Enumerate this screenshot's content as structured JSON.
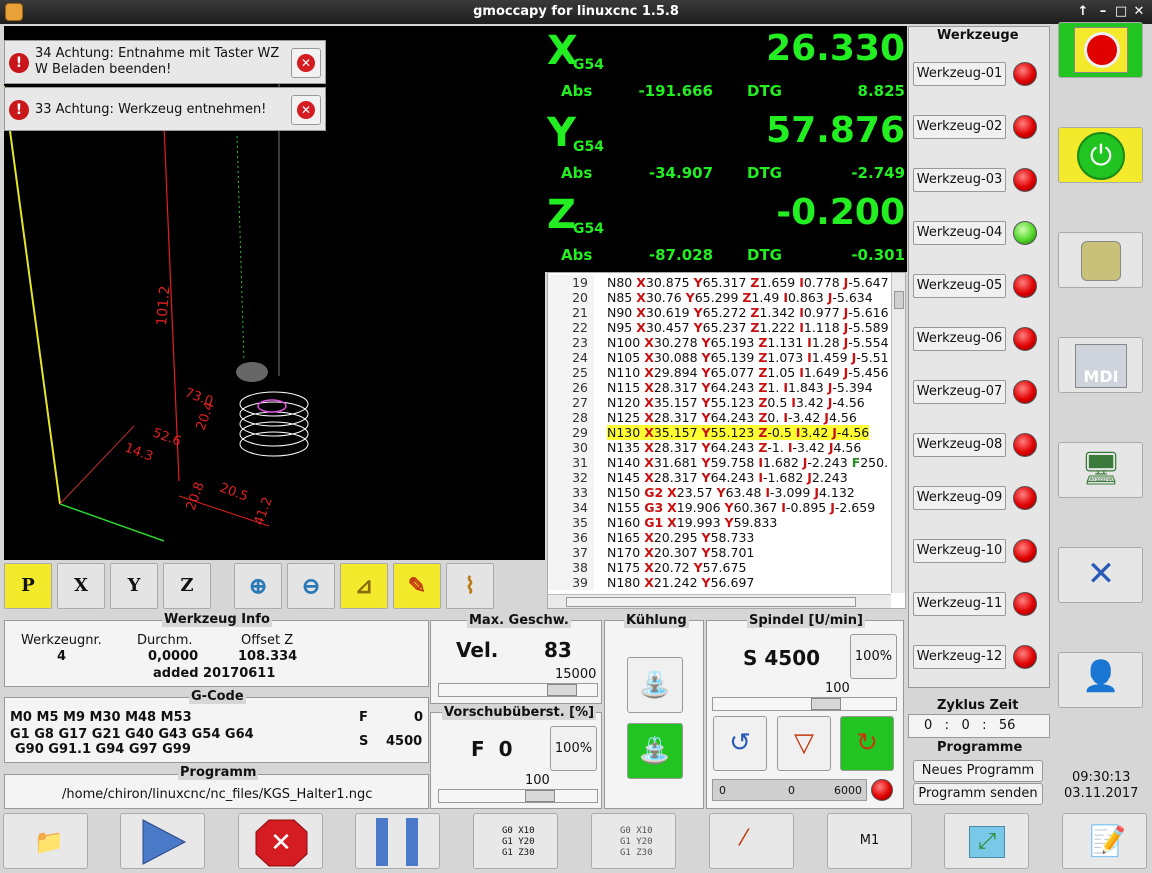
{
  "window": {
    "title": "gmoccapy for linuxcnc  1.5.8"
  },
  "messages": [
    {
      "text": "34 Achtung: Entnahme mit Taster WZ W Beladen beenden!"
    },
    {
      "text": "33 Achtung: Werkzeug entnehmen!"
    }
  ],
  "view_labels": {
    "d1": "101.2",
    "d2": "73.0",
    "d3": "20.4",
    "d4": "52.6",
    "d5": "14.3",
    "d6": "20.8",
    "d7": "20.5",
    "d8": "41.2"
  },
  "view_tools": {
    "p": "P",
    "x": "X",
    "y": "Y",
    "z": "Z"
  },
  "dro": [
    {
      "axis": "X",
      "sys": "G54",
      "value": "26.330",
      "abs_label": "Abs",
      "abs": "-191.666",
      "dtg_label": "DTG",
      "dtg": "8.825"
    },
    {
      "axis": "Y",
      "sys": "G54",
      "value": "57.876",
      "abs_label": "Abs",
      "abs": "-34.907",
      "dtg_label": "DTG",
      "dtg": "-2.749"
    },
    {
      "axis": "Z",
      "sys": "G54",
      "value": "-0.200",
      "abs_label": "Abs",
      "abs": "-87.028",
      "dtg_label": "DTG",
      "dtg": "-0.301"
    }
  ],
  "gcode_lines": [
    {
      "n": "19",
      "html": "N80 <b class='r'>X</b>30.875 <b class='r'>Y</b>65.317 <b class='r'>Z</b>1.659 <b class='r'>I</b>0.778 <b class='r'>J</b>-5.647"
    },
    {
      "n": "20",
      "html": "N85 <b class='r'>X</b>30.76 <b class='r'>Y</b>65.299 <b class='r'>Z</b>1.49 <b class='r'>I</b>0.863 <b class='r'>J</b>-5.634"
    },
    {
      "n": "21",
      "html": "N90 <b class='r'>X</b>30.619 <b class='r'>Y</b>65.272 <b class='r'>Z</b>1.342 <b class='r'>I</b>0.977 <b class='r'>J</b>-5.616"
    },
    {
      "n": "22",
      "html": "N95 <b class='r'>X</b>30.457 <b class='r'>Y</b>65.237 <b class='r'>Z</b>1.222 <b class='r'>I</b>1.118 <b class='r'>J</b>-5.589"
    },
    {
      "n": "23",
      "html": "N100 <b class='r'>X</b>30.278 <b class='r'>Y</b>65.193 <b class='r'>Z</b>1.131 <b class='r'>I</b>1.28 <b class='r'>J</b>-5.554"
    },
    {
      "n": "24",
      "html": "N105 <b class='r'>X</b>30.088 <b class='r'>Y</b>65.139 <b class='r'>Z</b>1.073 <b class='r'>I</b>1.459 <b class='r'>J</b>-5.51"
    },
    {
      "n": "25",
      "html": "N110 <b class='r'>X</b>29.894 <b class='r'>Y</b>65.077 <b class='r'>Z</b>1.05 <b class='r'>I</b>1.649 <b class='r'>J</b>-5.456"
    },
    {
      "n": "26",
      "html": "N115 <b class='r'>X</b>28.317 <b class='r'>Y</b>64.243 <b class='r'>Z</b>1. <b class='r'>I</b>1.843 <b class='r'>J</b>-5.394"
    },
    {
      "n": "27",
      "html": "N120 <b class='r'>X</b>35.157 <b class='r'>Y</b>55.123 <b class='r'>Z</b>0.5 <b class='r'>I</b>3.42 <b class='r'>J</b>-4.56"
    },
    {
      "n": "28",
      "html": "N125 <b class='r'>X</b>28.317 <b class='r'>Y</b>64.243 <b class='r'>Z</b>0. <b class='r'>I</b>-3.42 <b class='r'>J</b>4.56"
    },
    {
      "n": "29",
      "html": "N130 <b class='r'>X</b>35.157 <b class='r'>Y</b>55.123 <b class='r'>Z</b>-0.5 <b class='r'>I</b>3.42 <b class='r'>J</b>-4.56",
      "hl": true
    },
    {
      "n": "30",
      "html": "N135 <b class='r'>X</b>28.317 <b class='r'>Y</b>64.243 <b class='r'>Z</b>-1. <b class='r'>I</b>-3.42 <b class='r'>J</b>4.56"
    },
    {
      "n": "31",
      "html": "N140 <b class='r'>X</b>31.681 <b class='r'>Y</b>59.758 <b class='r'>I</b>1.682 <b class='r'>J</b>-2.243 <b class='g'>F</b>250."
    },
    {
      "n": "32",
      "html": "N145 <b class='r'>X</b>28.317 <b class='r'>Y</b>64.243 <b class='r'>I</b>-1.682 <b class='r'>J</b>2.243"
    },
    {
      "n": "33",
      "html": "N150 <b class='r'>G2</b> <b class='r'>X</b>23.57 <b class='r'>Y</b>63.48 <b class='r'>I</b>-3.099 <b class='r'>J</b>4.132"
    },
    {
      "n": "34",
      "html": "N155 <b class='r'>G3</b> <b class='r'>X</b>19.906 <b class='r'>Y</b>60.367 <b class='r'>I</b>-0.895 <b class='r'>J</b>-2.659"
    },
    {
      "n": "35",
      "html": "N160 <b class='r'>G1</b> <b class='r'>X</b>19.993 <b class='r'>Y</b>59.833"
    },
    {
      "n": "36",
      "html": "N165 <b class='r'>X</b>20.295 <b class='r'>Y</b>58.733"
    },
    {
      "n": "37",
      "html": "N170 <b class='r'>X</b>20.307 <b class='r'>Y</b>58.701"
    },
    {
      "n": "38",
      "html": "N175 <b class='r'>X</b>20.72 <b class='r'>Y</b>57.675"
    },
    {
      "n": "39",
      "html": "N180 <b class='r'>X</b>21.242 <b class='r'>Y</b>56.697"
    }
  ],
  "tools": {
    "title": "Werkzeuge",
    "items": [
      {
        "label": "Werkzeug-01",
        "active": false
      },
      {
        "label": "Werkzeug-02",
        "active": false
      },
      {
        "label": "Werkzeug-03",
        "active": false
      },
      {
        "label": "Werkzeug-04",
        "active": true
      },
      {
        "label": "Werkzeug-05",
        "active": false
      },
      {
        "label": "Werkzeug-06",
        "active": false
      },
      {
        "label": "Werkzeug-07",
        "active": false
      },
      {
        "label": "Werkzeug-08",
        "active": false
      },
      {
        "label": "Werkzeug-09",
        "active": false
      },
      {
        "label": "Werkzeug-10",
        "active": false
      },
      {
        "label": "Werkzeug-11",
        "active": false
      },
      {
        "label": "Werkzeug-12",
        "active": false
      }
    ]
  },
  "side": {
    "emergency_text": "Emergency Stop",
    "mdi_text": "MDI"
  },
  "tool_info": {
    "title": "Werkzeug Info",
    "nr_label": "Werkzeugnr.",
    "nr": "4",
    "dia_label": "Durchm.",
    "dia": "0,0000",
    "offset_label": "Offset Z",
    "offset": "108.334",
    "comment": "added 20170611"
  },
  "gcode_info": {
    "title": "G-Code",
    "line1": "M0 M5 M9 M30 M48 M53",
    "line2": "G1 G8 G17 G21 G40 G43 G54 G64",
    "line3": "G90 G91.1 G94 G97 G99",
    "f_label": "F",
    "f": "0",
    "s_label": "S",
    "s": "4500"
  },
  "program": {
    "title": "Programm",
    "path": "/home/chiron/linuxcnc/nc_files/KGS_Halter1.ngc"
  },
  "max_vel": {
    "title": "Max. Geschw.",
    "label": "Vel.",
    "value": "83",
    "max": "15000",
    "level_pct": 86
  },
  "feed_override": {
    "title": "Vorschubüberst. [%]",
    "label": "F  0",
    "btn": "100%",
    "scale": "100",
    "level_pct": 68
  },
  "cooling": {
    "title": "Kühlung"
  },
  "spindle": {
    "title": "Spindel [U/min]",
    "value": "S 4500",
    "btn": "100%",
    "scale": "100",
    "level_pct": 65,
    "bar_min": "0",
    "bar_val": "0",
    "bar_max": "6000"
  },
  "cycle": {
    "title": "Zyklus Zeit",
    "time": "0   :   0   :   56"
  },
  "programs": {
    "title": "Programme",
    "new_btn": "Neues Programm",
    "send_btn": "Programm senden"
  },
  "clock": {
    "time": "09:30:13",
    "date": "03.11.2017"
  },
  "bottom": {
    "m1": "M1"
  },
  "colors": {
    "dro_green": "#22ee22",
    "highlight": "#ffff33",
    "accent_yellow": "#f2ea2a",
    "active_green": "#21c421"
  }
}
